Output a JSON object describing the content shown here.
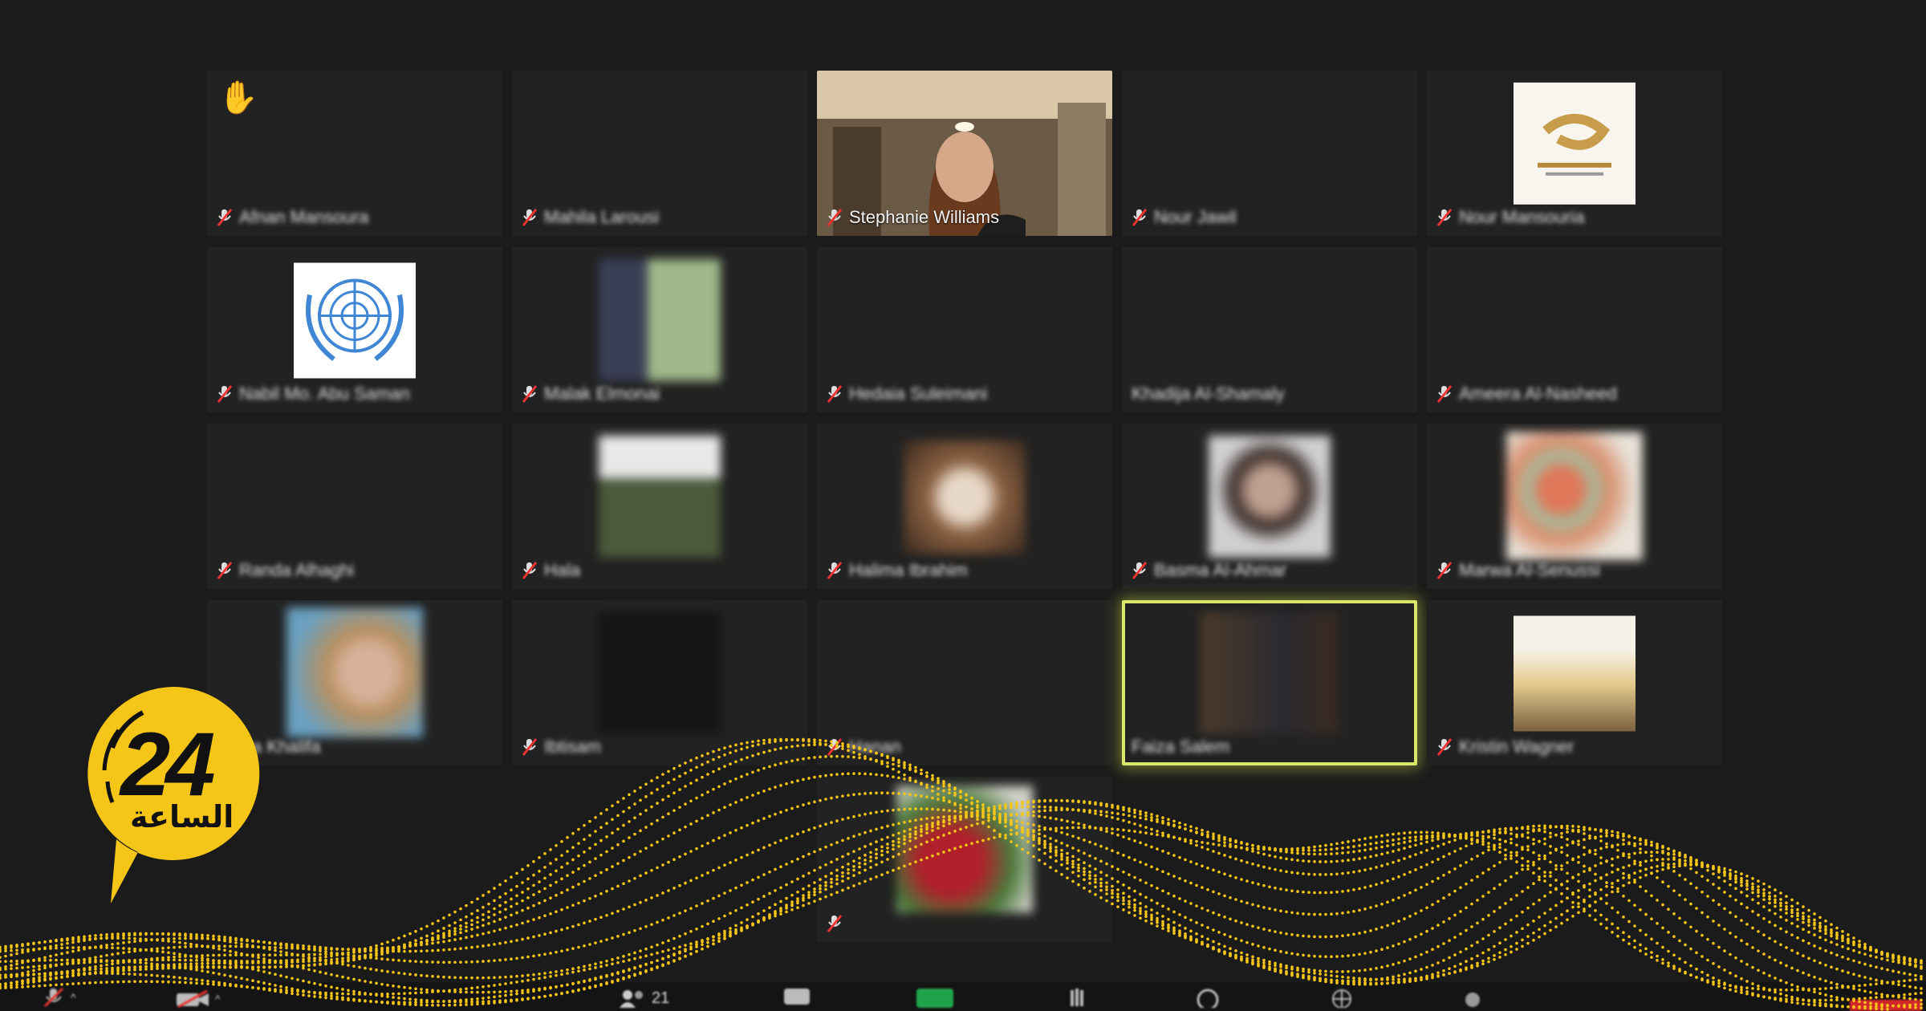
{
  "meeting": {
    "participant_count": "21",
    "tiles": [
      {
        "id": "t1",
        "name": "Afnan Mansoura",
        "raised_hand": true,
        "muted": true,
        "blur": true,
        "video": "none"
      },
      {
        "id": "t2",
        "name": "Mahila Larousi",
        "muted": true,
        "blur": true,
        "video": "none"
      },
      {
        "id": "t3",
        "name": "Stephanie Williams",
        "muted": true,
        "blur": false,
        "video": "camera"
      },
      {
        "id": "t4",
        "name": "Nour Jawil",
        "muted": true,
        "blur": true,
        "video": "none"
      },
      {
        "id": "t5",
        "name": "Nour Mansouria",
        "muted": true,
        "blur": true,
        "video": "logo-gold"
      },
      {
        "id": "t6",
        "name": "Nabil Mo. Abu Saman",
        "muted": true,
        "blur": true,
        "video": "un-emblem"
      },
      {
        "id": "t7",
        "name": "Malak Elmonai",
        "muted": true,
        "blur": true,
        "video": "photo-green"
      },
      {
        "id": "t8",
        "name": "Hedaia Suleimani",
        "muted": true,
        "blur": true,
        "video": "none"
      },
      {
        "id": "t9",
        "name": "Khadija Al-Shamaly",
        "muted": false,
        "blur": true,
        "video": "none"
      },
      {
        "id": "t10",
        "name": "Ameera Al-Nasheed",
        "muted": true,
        "blur": true,
        "video": "none"
      },
      {
        "id": "t11",
        "name": "Randa Alhaghi",
        "muted": true,
        "blur": true,
        "video": "none"
      },
      {
        "id": "t12",
        "name": "Hala",
        "muted": true,
        "blur": true,
        "video": "photo-trees"
      },
      {
        "id": "t13",
        "name": "Halima Ibrahim",
        "muted": true,
        "blur": true,
        "video": "photo-warm"
      },
      {
        "id": "t14",
        "name": "Basma Al-Ahmar",
        "muted": true,
        "blur": true,
        "video": "photo-woman"
      },
      {
        "id": "t15",
        "name": "Marwa Al-Senussi",
        "muted": true,
        "blur": true,
        "video": "photo-flowers"
      },
      {
        "id": "t16",
        "name": "Asma Khalifa",
        "muted": false,
        "blur": true,
        "video": "photo-face"
      },
      {
        "id": "t17",
        "name": "Ibtisam",
        "muted": true,
        "blur": true,
        "video": "photo-dark"
      },
      {
        "id": "t18",
        "name": "Hanan",
        "muted": true,
        "blur": true,
        "video": "none"
      },
      {
        "id": "t19",
        "name": "Faiza Salem",
        "muted": false,
        "blur": true,
        "video": "photo-dark2",
        "active": true
      },
      {
        "id": "t20",
        "name": "Kristin Wagner",
        "muted": true,
        "blur": true,
        "video": "photo-sunset"
      },
      {
        "id": "t21",
        "name": "",
        "muted": true,
        "blur": true,
        "video": "photo-red"
      }
    ]
  },
  "brand": {
    "logo_number": "24",
    "logo_text": "الساعة",
    "accent_color": "#f5c518"
  },
  "toolbar": {
    "icons": [
      "mic-muted-icon",
      "video-off-icon",
      "participants-icon",
      "chat-icon",
      "share-screen-icon",
      "record-icon",
      "reactions-icon",
      "apps-icon",
      "more-icon",
      "end-icon"
    ]
  }
}
